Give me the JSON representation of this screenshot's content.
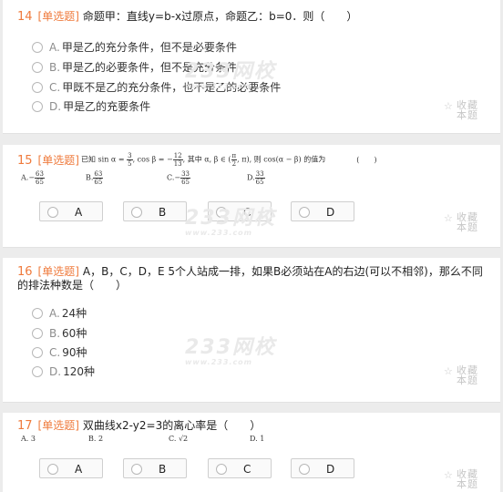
{
  "favorite_label": "收藏本题",
  "watermark": {
    "brand": "233网校",
    "url": "www.233.com"
  },
  "q14": {
    "number": "14",
    "type": "[单选题]",
    "text": "命题甲：直线y=b-x过原点，命题乙：b=0．则（　　）",
    "options": [
      {
        "letter": "A.",
        "text": "甲是乙的充分条件，但不是必要条件"
      },
      {
        "letter": "B.",
        "text": "甲是乙的必要条件，但不是充分条件"
      },
      {
        "letter": "C.",
        "text": "甲既不是乙的充分条件，也不是乙的必要条件"
      },
      {
        "letter": "D.",
        "text": "甲是乙的充要条件"
      }
    ]
  },
  "q15": {
    "number": "15",
    "type": "[单选题]",
    "text_pre": "已知 sin α = ",
    "sin_num": "3",
    "sin_den": "5",
    "text_mid": ", cos β = −",
    "cos_num": "12",
    "cos_den": "13",
    "text_mid2": ", 其中 α, β ∈ (",
    "pi_num": "π",
    "pi_den": "2",
    "text_post": ", π), 则 cos(α − β) 的值为",
    "paren": "(　　)",
    "choices": [
      {
        "letter": "A.",
        "sign": "−",
        "num": "63",
        "den": "65"
      },
      {
        "letter": "B.",
        "sign": "",
        "num": "63",
        "den": "65"
      },
      {
        "letter": "C.",
        "sign": "−",
        "num": "33",
        "den": "65"
      },
      {
        "letter": "D.",
        "sign": "",
        "num": "33",
        "den": "65"
      }
    ],
    "buttons": [
      "A",
      "B",
      "C",
      "D"
    ]
  },
  "q16": {
    "number": "16",
    "type": "[单选题]",
    "text_line1": "A，B，C，D，E 5个人站成一排，如果B必须站在A的右边(可以不相邻)，那么不同",
    "text_line2": "的排法种数是（　　）",
    "options": [
      {
        "letter": "A.",
        "text": "24种"
      },
      {
        "letter": "B.",
        "text": "60种"
      },
      {
        "letter": "C.",
        "text": "90种"
      },
      {
        "letter": "D.",
        "text": "120种"
      }
    ]
  },
  "q17": {
    "number": "17",
    "type": "[单选题]",
    "text": "双曲线x2-y2=3的离心率是（　　）",
    "choices": [
      {
        "letter": "A.",
        "value": "3"
      },
      {
        "letter": "B.",
        "value": "2"
      },
      {
        "letter": "C.",
        "value": "√2"
      },
      {
        "letter": "D.",
        "value": "1"
      }
    ],
    "buttons": [
      "A",
      "B",
      "C",
      "D"
    ]
  }
}
